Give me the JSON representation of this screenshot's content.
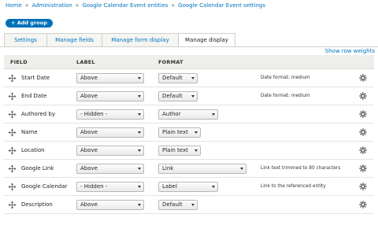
{
  "breadcrumb": [
    "Home",
    "Administration",
    "Google Calendar Event entities",
    "Google Calendar Event settings"
  ],
  "breadcrumb_sep": "»",
  "add_group_label": "+ Add group",
  "tabs": [
    {
      "label": "Settings",
      "active": false
    },
    {
      "label": "Manage fields",
      "active": false
    },
    {
      "label": "Manage form display",
      "active": false
    },
    {
      "label": "Manage display",
      "active": true
    }
  ],
  "show_row_weights": "Show row weights",
  "columns": {
    "field": "FIELD",
    "label": "LABEL",
    "format": "FORMAT"
  },
  "rows": [
    {
      "field": "Start Date",
      "label": "Above",
      "format": "Default",
      "summary": "Date format: medium"
    },
    {
      "field": "End Date",
      "label": "Above",
      "format": "Default",
      "summary": "Date format: medium"
    },
    {
      "field": "Authored by",
      "label": "- Hidden -",
      "format": "Author",
      "summary": ""
    },
    {
      "field": "Name",
      "label": "Above",
      "format": "Plain text",
      "summary": ""
    },
    {
      "field": "Location",
      "label": "Above",
      "format": "Plain text",
      "summary": ""
    },
    {
      "field": "Google Link",
      "label": "Above",
      "format": "Link",
      "summary": "Link text trimmed to 80 characters"
    },
    {
      "field": "Google Calendar",
      "label": "- Hidden -",
      "format": "Label",
      "summary": "Link to the referenced entity"
    },
    {
      "field": "Description",
      "label": "Above",
      "format": "Default",
      "summary": ""
    }
  ],
  "icons": {
    "drag": "move-handle-icon",
    "settings": "gear-icon"
  },
  "colors": {
    "link": "#0074bd",
    "button": "#0071b8",
    "header_bg": "#eeeeea"
  }
}
